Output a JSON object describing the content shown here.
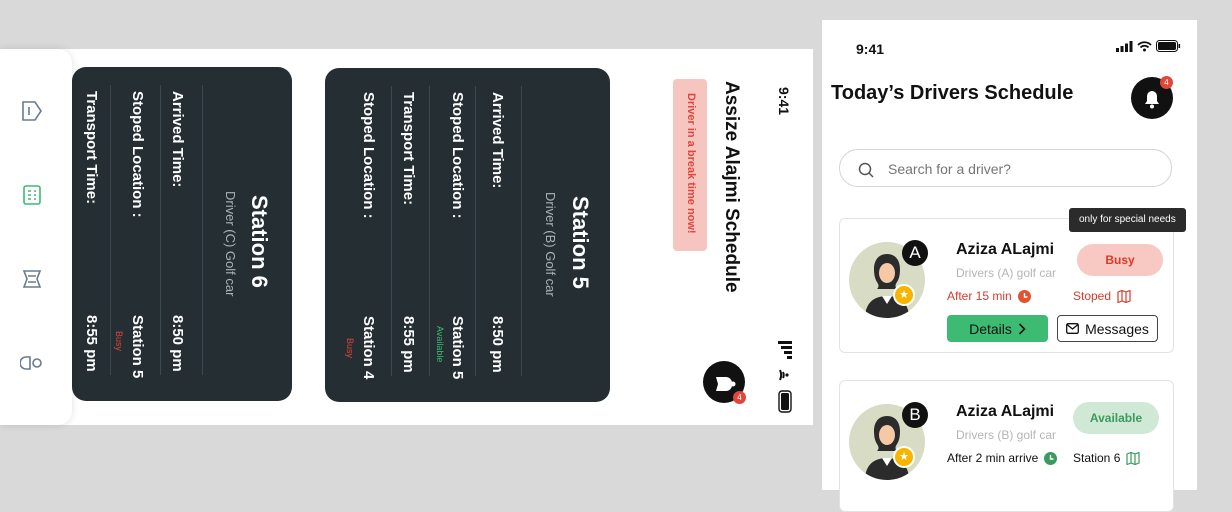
{
  "left_screen": {
    "time": "9:41",
    "title": "Assize Alajmi Schedule",
    "break_banner": "Driver in a break time now!",
    "notification_count": "4",
    "cards": [
      {
        "station": "Station 5",
        "driver": "Driver (B) Golf car",
        "arrived_label": "Arrived Time:",
        "arrived_value": "8:50 pm",
        "stoped_label": "Stoped Location :",
        "stoped_value": "Station 5",
        "stoped_status": "Available",
        "transport_label": "Transport Time:",
        "transport_value": "8:55 pm",
        "stoped_label_2": "Stoped Location :",
        "stoped_value_2": "Station 4",
        "stoped_status_2": "Busy"
      },
      {
        "station": "Station 6",
        "driver": "Driver (C) Golf car",
        "arrived_label": "Arrived Time:",
        "arrived_value": "8:50 pm",
        "stoped_label": "Stoped Location :",
        "stoped_value": "Station 5",
        "stoped_status": "Busy",
        "transport_label": "Transport Time:",
        "transport_value": "8:55 pm"
      }
    ],
    "sidebar_icons": [
      "driver-tag-icon",
      "schedule-icon",
      "ticket-icon",
      "toggle-icon"
    ]
  },
  "right_screen": {
    "time": "9:41",
    "title": "Today’s Drivers Schedule",
    "notification_count": "4",
    "search_placeholder": "Search for a driver?",
    "tooltip": "only for special needs",
    "drivers": [
      {
        "letter": "A",
        "name": "Aziza ALajmi",
        "vehicle": "Drivers (A) golf car",
        "status": "Busy",
        "eta": "After 15 min",
        "location": "Stoped",
        "details_label": "Details",
        "messages_label": "Messages"
      },
      {
        "letter": "B",
        "name": "Aziza ALajmi",
        "vehicle": "Drivers (B) golf car",
        "status": "Available",
        "eta": "After 2 min arrive",
        "location": "Station 6"
      }
    ]
  },
  "colors": {
    "card_bg": "#252e33",
    "busy": "#d93a2b",
    "busy_pill": "#f8c9c3",
    "available": "#3a9b5c",
    "available_pill": "#cfe9d6",
    "details_btn": "#3dbb73"
  }
}
